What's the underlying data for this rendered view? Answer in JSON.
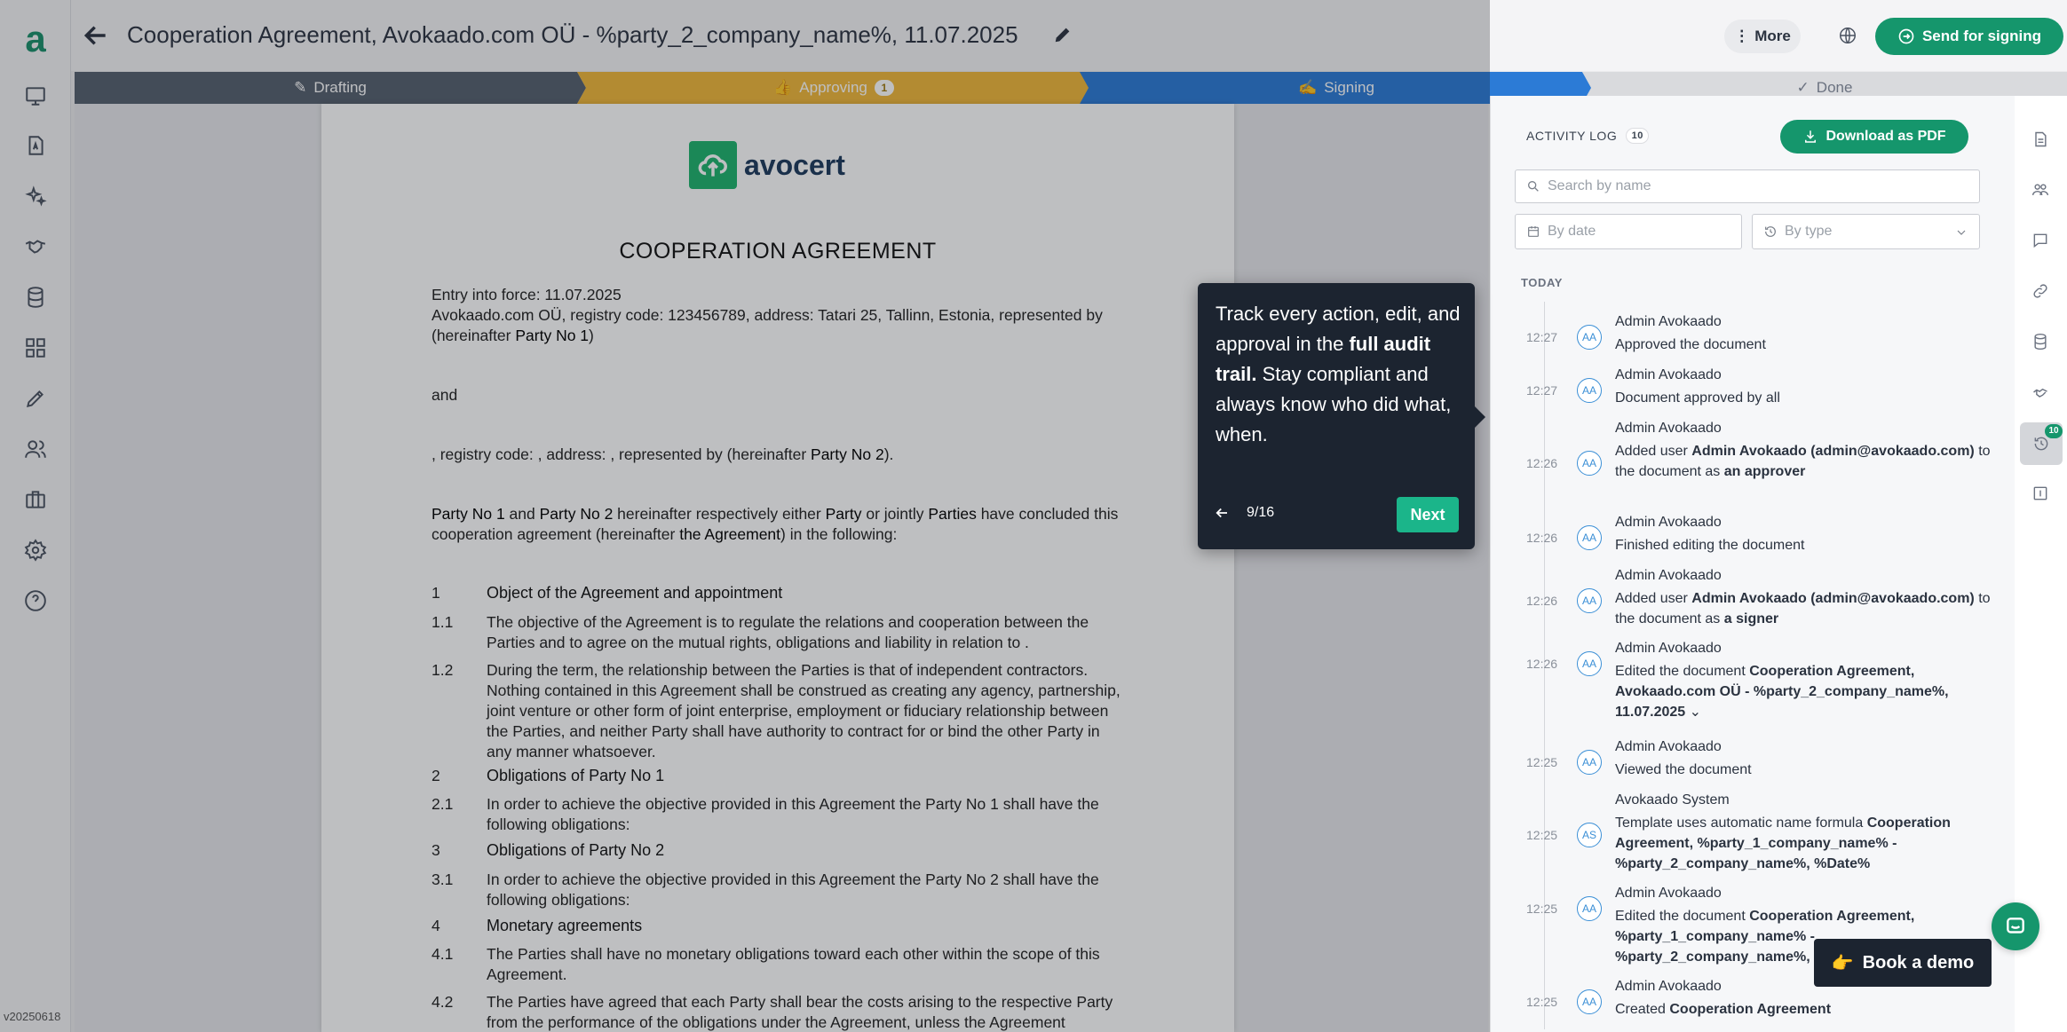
{
  "app": {
    "logo_text": "a",
    "version": "v20250618"
  },
  "header": {
    "title": "Cooperation Agreement, Avokaado.com OÜ - %party_2_company_name%, 11.07.2025",
    "more_label": "More",
    "send_label": "Send for signing"
  },
  "steps": {
    "drafting": "Drafting",
    "approving": "Approving",
    "approving_count": "1",
    "signing": "Signing",
    "done": "Done"
  },
  "document": {
    "logo_name": "avocert",
    "heading": "COOPERATION AGREEMENT",
    "entry": "Entry into force: 11.07.2025",
    "party1_line1": "Avokaado.com OÜ, registry code: 123456789, address: Tatari 25, Tallinn, Estonia, represented by",
    "party1_line2_pre": "(hereinafter ",
    "party1_line2_bold": "Party No 1",
    "party1_line2_post": ")",
    "and": "and",
    "party2_pre": ", registry code: , address: , represented by    (hereinafter ",
    "party2_bold": "Party No 2",
    "party2_post": ").",
    "intro_l1_a": "Party No 1",
    "intro_l1_b": " and ",
    "intro_l1_c": "Party No 2",
    "intro_l1_d": " hereinafter respectively either ",
    "intro_l1_e": "Party",
    "intro_l1_f": " or jointly ",
    "intro_l1_g": "Parties",
    "intro_l1_h": " have concluded this",
    "intro_l2_a": "cooperation agreement (hereinafter ",
    "intro_l2_b": "the Agreement",
    "intro_l2_c": ") in the following:",
    "s1_num": "1",
    "s1_title": "Object of the Agreement and appointment",
    "s11_num": "1.1",
    "s11_l1": "The objective of the Agreement is to regulate the relations and cooperation between the",
    "s11_l2": "Parties and to agree on the mutual rights, obligations and liability in relation to .",
    "s12_num": "1.2",
    "s12_l1": "During the term, the relationship between the Parties is that of independent contractors.",
    "s12_l2": "Nothing contained in this Agreement shall be construed as creating any agency, partnership,",
    "s12_l3": "joint venture or other form of joint enterprise, employment or fiduciary relationship between",
    "s12_l4": "the Parties, and neither Party shall have authority to contract for or bind the other Party in",
    "s12_l5": "any manner whatsoever.",
    "s2_num": "2",
    "s2_title": "Obligations of Party No 1",
    "s21_num": "2.1",
    "s21_l1": "In order to achieve the objective provided in this Agreement the Party No 1 shall have the",
    "s21_l2": "following obligations:",
    "s3_num": "3",
    "s3_title": "Obligations of Party No 2",
    "s31_num": "3.1",
    "s31_l1": "In order to achieve the objective provided in this Agreement the Party No 2 shall have the",
    "s31_l2": "following obligations:",
    "s4_num": "4",
    "s4_title": "Monetary agreements",
    "s41_num": "4.1",
    "s41_l1": "The Parties shall have no monetary obligations toward each other within the scope of this",
    "s41_l2": "Agreement.",
    "s42_num": "4.2",
    "s42_l1": "The Parties have agreed that each Party shall bear the costs arising to the respective Party",
    "s42_l2": "from the performance of the obligations under the Agreement, unless the Agreement"
  },
  "activity": {
    "title": "ACTIVITY LOG",
    "count": "10",
    "pdf_label": "Download as PDF",
    "search_placeholder": "Search by name",
    "date_placeholder": "By date",
    "type_placeholder": "By type",
    "section": "TODAY",
    "entries": [
      {
        "time": "12:27",
        "avatar": "AA",
        "who": "Admin Avokaado",
        "text": "Approved the document"
      },
      {
        "time": "12:27",
        "avatar": "AA",
        "who": "Admin Avokaado",
        "text": "Document approved by all"
      },
      {
        "time": "12:26",
        "avatar": "AA",
        "who": "Admin Avokaado",
        "t1": "Added user ",
        "b1": "Admin Avokaado (admin@avokaado.com)",
        "t2": " to the document as ",
        "b2": "an approver"
      },
      {
        "time": "12:26",
        "avatar": "AA",
        "who": "Admin Avokaado",
        "text": "Finished editing the document"
      },
      {
        "time": "12:26",
        "avatar": "AA",
        "who": "Admin Avokaado",
        "t1": "Added user ",
        "b1": "Admin Avokaado (admin@avokaado.com)",
        "t2": " to the document as ",
        "b2": "a signer"
      },
      {
        "time": "12:26",
        "avatar": "AA",
        "who": "Admin Avokaado",
        "t1": "Edited the document ",
        "b1": "Cooperation Agreement, Avokaado.com OÜ - %party_2_company_name%, 11.07.2025"
      },
      {
        "time": "12:25",
        "avatar": "AA",
        "who": "Admin Avokaado",
        "text": "Viewed the document"
      },
      {
        "time": "12:25",
        "avatar": "AS",
        "who": "Avokaado System",
        "t1": "Template uses automatic name formula ",
        "b1": "Cooperation Agreement, %party_1_company_name% - %party_2_company_name%, %Date%"
      },
      {
        "time": "12:25",
        "avatar": "AA",
        "who": "Admin Avokaado",
        "t1": "Edited the document ",
        "b1": "Cooperation Agreement, %party_1_company_name% - %party_2_company_name%,"
      },
      {
        "time": "12:25",
        "avatar": "AA",
        "who": "Admin Avokaado",
        "t1": "Created ",
        "b1": "Cooperation Agreement"
      }
    ],
    "side_badge": "10"
  },
  "tour": {
    "m1": "Track every action, edit, and approval in the ",
    "m2": "full audit trail.",
    "m3": " Stay compliant and always know who did what, when.",
    "counter": "9/16",
    "next": "Next"
  },
  "demo_label": "Book a demo",
  "demo_emoji": "👉",
  "colors": {
    "brand_green": "#15966c",
    "drafting": "#55606e",
    "approving": "#f0b73a",
    "signing": "#2c7bd6",
    "done": "#d9dadd"
  }
}
